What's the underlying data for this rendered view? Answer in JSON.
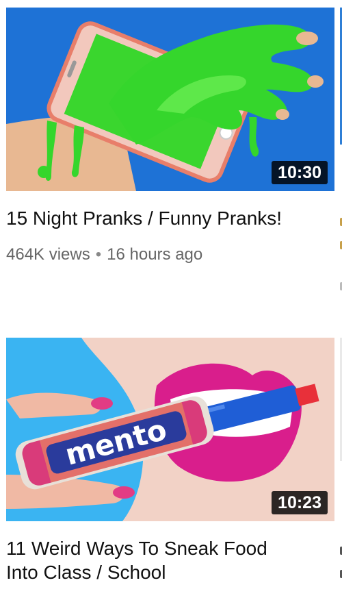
{
  "videos": [
    {
      "title": "15 Night Pranks / Funny Pranks!",
      "duration": "10:30",
      "views": "464K views",
      "separator": "•",
      "age": "16 hours ago",
      "thumbnail_icon": "slime-hand-phone-thumbnail"
    },
    {
      "title": "11 Weird Ways To Sneak Food Into Class / School",
      "duration": "10:23",
      "thumbnail_icon": "mentos-marker-lips-thumbnail",
      "thumbnail_text": "mento"
    }
  ],
  "colors": {
    "thumb1_bg": "#1e72d6",
    "slime": "#35d62c",
    "thumb2_bg": "#3ab4f2",
    "lips": "#d91e8c",
    "marker": "#1f5ed6",
    "mentos_label": "#2a3b9c"
  }
}
